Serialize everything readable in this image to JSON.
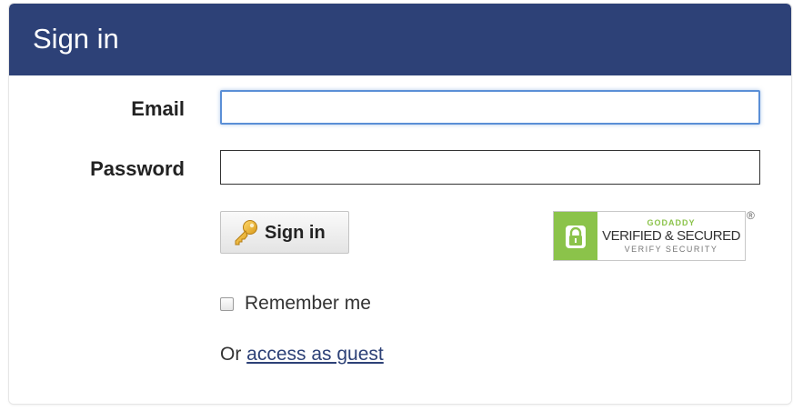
{
  "header": {
    "title": "Sign in"
  },
  "form": {
    "email_label": "Email",
    "email_value": "",
    "password_label": "Password",
    "password_value": "",
    "submit_label": "Sign in",
    "submit_icon": "key-icon",
    "remember_label": "Remember me",
    "remember_checked": false,
    "guest_prefix": "Or",
    "guest_link": "access as guest"
  },
  "badge": {
    "brand": "GODADDY",
    "main": "VERIFIED & SECURED",
    "sub": "VERIFY SECURITY",
    "registered": "®",
    "icon": "padlock-icon"
  },
  "colors": {
    "header": "#2d4177",
    "focus": "#5b8fd6",
    "badge_green": "#8bc34a",
    "link": "#2d4177"
  }
}
